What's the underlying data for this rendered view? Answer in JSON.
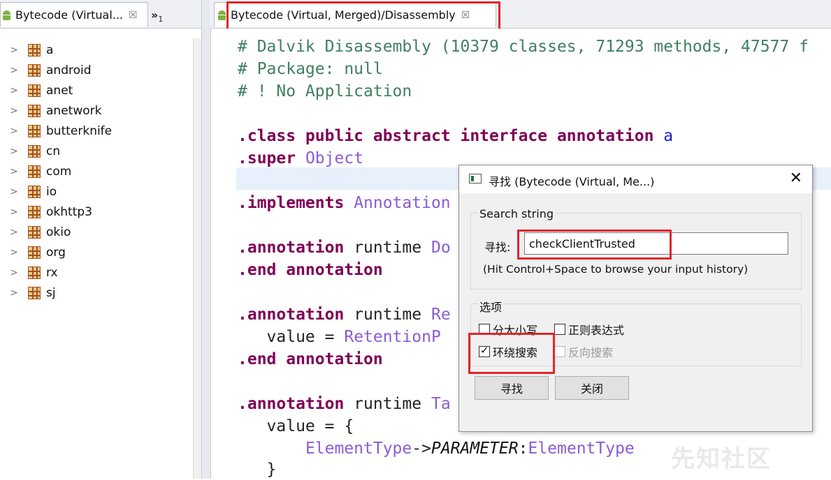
{
  "left_panel": {
    "tab_label": "Bytecode (Virtual...",
    "tab_close": "☒",
    "overflow_chevron": "»",
    "overflow_count": "1",
    "tree": [
      {
        "label": "a",
        "selected": true
      },
      {
        "label": "android"
      },
      {
        "label": "anet"
      },
      {
        "label": "anetwork"
      },
      {
        "label": "butterknife"
      },
      {
        "label": "cn"
      },
      {
        "label": "com"
      },
      {
        "label": "io"
      },
      {
        "label": "okhttp3"
      },
      {
        "label": "okio"
      },
      {
        "label": "org"
      },
      {
        "label": "rx"
      },
      {
        "label": "sj"
      }
    ]
  },
  "editor": {
    "tab_label": "Bytecode (Virtual, Merged)/Disassembly",
    "tab_close": "☒",
    "lines": {
      "l1": "# Dalvik Disassembly (10379 classes, 71293 methods, 47577 f",
      "l2": "# Package: null",
      "l3": "# ! No Application",
      "l4_kw": ".class public abstract interface annotation",
      "l4_id": "a",
      "l5_kw": ".super",
      "l5_ref": "Object",
      "l6_kw": ".implements",
      "l6_ref": "Annotation",
      "l7_kw": ".annotation",
      "l7_plain": "runtime",
      "l7_ref": "Do",
      "l8_kw": ".end annotation",
      "l9_kw": ".annotation",
      "l9_plain": "runtime",
      "l9_ref": "Re",
      "l10_plain": "value =",
      "l10_ref": "RetentionP",
      "l11_kw": ".end annotation",
      "l12_kw": ".annotation",
      "l12_plain": "runtime",
      "l12_ref": "Ta",
      "l13_plain": "value = {",
      "l14_ref1": "ElementType",
      "l14_arrow": "->",
      "l14_it": "PARAMETER",
      "l14_colon": ":",
      "l14_ref2": "ElementType",
      "l15_plain": "}"
    }
  },
  "dialog": {
    "title": "寻找 (Bytecode (Virtual, Me...)",
    "close_glyph": "✕",
    "search_group_label": "Search string",
    "find_label": "寻找:",
    "find_value": "checkClientTrusted",
    "hint": "(Hit Control+Space to browse your input history)",
    "options_group_label": "选项",
    "options": {
      "case_sensitive": {
        "label": "分大小写",
        "checked": false
      },
      "regex": {
        "label": "正则表达式",
        "checked": false
      },
      "wrap_around": {
        "label": "环绕搜索",
        "checked": true
      },
      "reverse": {
        "label": "反向搜索",
        "checked": false,
        "disabled": true
      }
    },
    "find_button": "寻找",
    "close_button": "关闭"
  },
  "watermark": "先知社区",
  "colors": {
    "highlight_red": "#e0262b",
    "comment_green": "#3f7f5f",
    "keyword_purple": "#7f0055",
    "reference_violet": "#8a5cd6"
  }
}
